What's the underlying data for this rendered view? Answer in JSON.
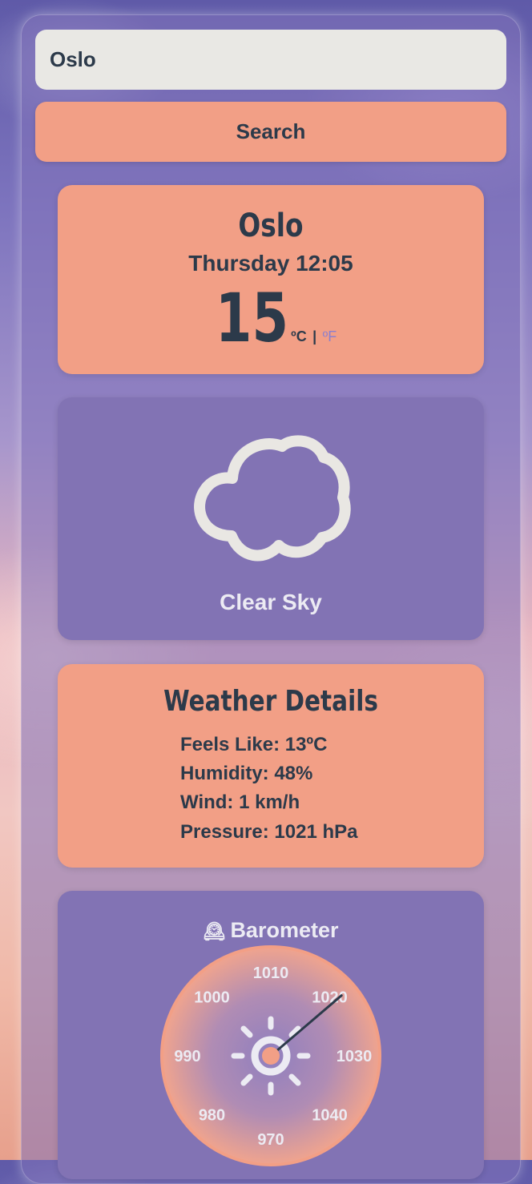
{
  "search": {
    "value": "Oslo",
    "placeholder": "",
    "button_label": "Search"
  },
  "current": {
    "city": "Oslo",
    "datetime": "Thursday 12:05",
    "temperature": "15",
    "unit_celsius": "ºC",
    "separator": "|",
    "unit_fahrenheit": "ºF"
  },
  "condition": {
    "icon": "cloud-icon",
    "label": "Clear Sky"
  },
  "details": {
    "title": "Weather Details",
    "feels_like": "Feels Like: 13ºC",
    "humidity": "Humidity: 48%",
    "wind": "Wind: 1 km/h",
    "pressure": "Pressure: 1021 hPa"
  },
  "barometer": {
    "icon": "mantelpiece-clock-icon",
    "title": "Barometer",
    "value_hpa": 1021,
    "scale_labels": [
      "1010",
      "1000",
      "1020",
      "990",
      "1030",
      "980",
      "1040",
      "970"
    ]
  },
  "colors": {
    "salmon": "#f29f86",
    "purple": "#8273b4",
    "text_dark": "#2c3a4a",
    "text_light": "#ecebf3"
  }
}
